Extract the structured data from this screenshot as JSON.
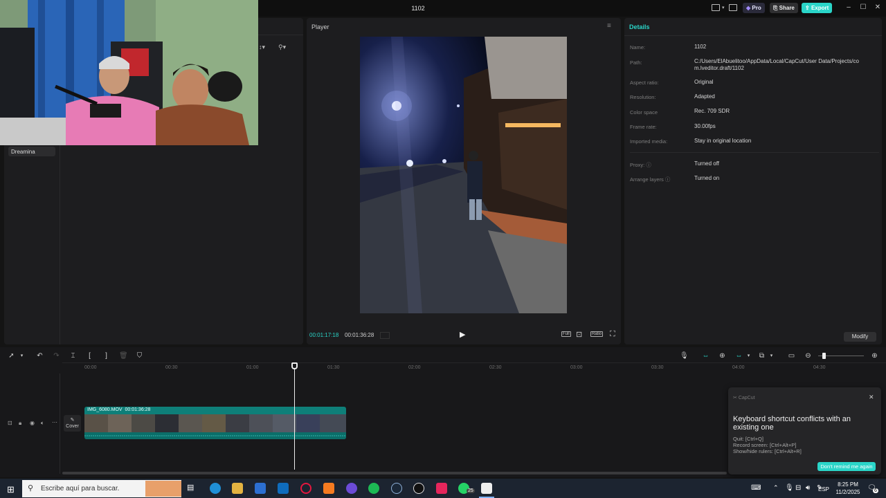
{
  "window": {
    "title": "1102",
    "pro_label": "Pro",
    "share_label": "Share",
    "export_label": "Export",
    "accent": "#2ad5c8"
  },
  "left_panel": {
    "dreamina_label": "Dreamina"
  },
  "player": {
    "title": "Player",
    "current_time": "00:01:17:18",
    "total_time": "00:01:36:28",
    "full_label": "Full",
    "ratio_label": "Ratio"
  },
  "details": {
    "title": "Details",
    "rows": [
      {
        "label": "Name:",
        "value": "1102"
      },
      {
        "label": "Path:",
        "value": "C:/Users/ElAbuelitoo/AppData/Local/CapCut/User Data/Projects/com.lveditor.draft/1102"
      },
      {
        "label": "Aspect ratio:",
        "value": "Original"
      },
      {
        "label": "Resolution:",
        "value": "Adapted"
      },
      {
        "label": "Color space",
        "value": "Rec. 709 SDR"
      },
      {
        "label": "Frame rate:",
        "value": "30.00fps"
      },
      {
        "label": "Imported media:",
        "value": "Stay in original location"
      },
      {
        "label": "Proxy:",
        "value": "Turned off"
      },
      {
        "label": "Arrange layers",
        "value": "Turned on"
      }
    ],
    "modify_label": "Modify"
  },
  "timeline": {
    "ticks": [
      "00:00",
      "00:30",
      "01:00",
      "01:30",
      "02:00",
      "02:30",
      "03:00",
      "03:30",
      "04:00",
      "04:30"
    ],
    "cover_label": "Cover",
    "clip_name": "IMG_6080.MOV",
    "clip_duration": "00:01:36:28"
  },
  "notification": {
    "app": "CapCut",
    "heading": "Keyboard shortcut conflicts with an existing one",
    "lines": [
      "Quit: [Ctrl+Q]",
      "Record screen: [Ctrl+Alt+P]",
      "Show/hide rulers: [Ctrl+Alt+R]"
    ],
    "button": "Don't remind me again"
  },
  "taskbar": {
    "search_placeholder": "Escribe aquí para buscar.",
    "whatsapp_badge": "25",
    "language": "ESP",
    "time": "8:25 PM",
    "date": "11/2/2025",
    "notif_count": "6"
  }
}
